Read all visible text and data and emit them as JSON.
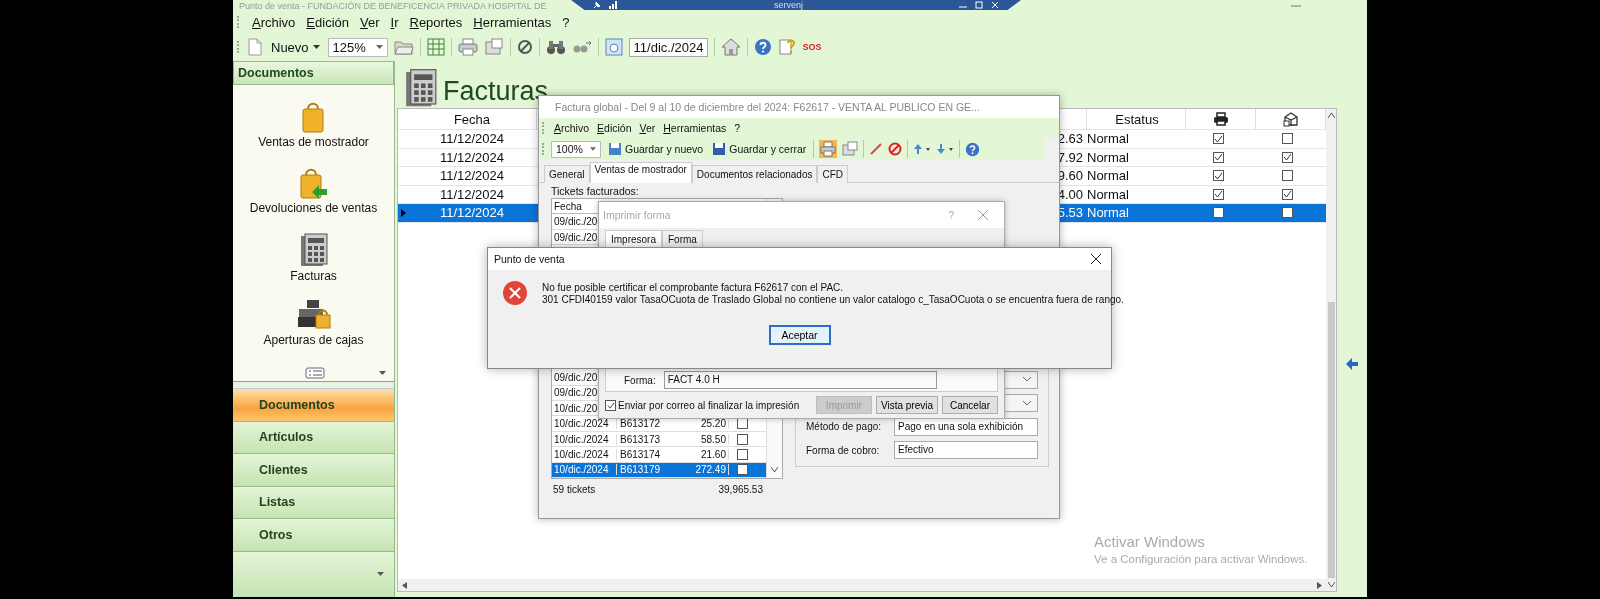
{
  "remote_bar": {
    "title": "servenj"
  },
  "window": {
    "title": "Punto de venta - FUNDACIÓN DE BENEFICENCIA PRIVADA HOSPITAL DE"
  },
  "menu": [
    "Archivo",
    "Edición",
    "Ver",
    "Ir",
    "Reportes",
    "Herramientas",
    "?"
  ],
  "toolbar": {
    "new_label": "Nuevo",
    "zoom": "125%",
    "date": "11/dic./2024",
    "sos": "SOS"
  },
  "sidebar": {
    "header": "Documentos",
    "items": [
      {
        "label": "Ventas de mostrador"
      },
      {
        "label": "Devoluciones de ventas"
      },
      {
        "label": "Facturas"
      },
      {
        "label": "Aperturas de cajas"
      }
    ],
    "nav": [
      {
        "label": "Documentos",
        "selected": true
      },
      {
        "label": "Artículos",
        "selected": false
      },
      {
        "label": "Clientes",
        "selected": false
      },
      {
        "label": "Listas",
        "selected": false
      },
      {
        "label": "Otros",
        "selected": false
      }
    ]
  },
  "page": {
    "title": "Facturas"
  },
  "table": {
    "columns": {
      "date": "Fecha",
      "status": "Estatus"
    },
    "rows": [
      {
        "date": "11/12/2024",
        "amount": "2.63",
        "status": "Normal",
        "printed": true,
        "sent": false,
        "selected": false
      },
      {
        "date": "11/12/2024",
        "amount": "7.92",
        "status": "Normal",
        "printed": true,
        "sent": true,
        "selected": false
      },
      {
        "date": "11/12/2024",
        "amount": "9.60",
        "status": "Normal",
        "printed": true,
        "sent": false,
        "selected": false
      },
      {
        "date": "11/12/2024",
        "amount": "4.00",
        "status": "Normal",
        "printed": true,
        "sent": true,
        "selected": false
      },
      {
        "date": "11/12/2024",
        "amount": "5.53",
        "status": "Normal",
        "printed": false,
        "sent": false,
        "selected": true
      }
    ]
  },
  "factura": {
    "title": "Factura global - Del 9 al 10 de diciembre del 2024: F62617 - VENTA AL PUBLICO EN GE...",
    "menu": [
      "Archivo",
      "Edición",
      "Ver",
      "Herramientas",
      "?"
    ],
    "zoom": "100%",
    "save_new": "Guardar y nuevo",
    "save_close": "Guardar y cerrar",
    "tabs": [
      {
        "label": "General",
        "selected": false
      },
      {
        "label": "Ventas de mostrador",
        "selected": true
      },
      {
        "label": "Documentos relacionados",
        "selected": false
      },
      {
        "label": "CFD",
        "selected": false
      }
    ],
    "tickets_label": "Tickets facturados:",
    "tickets_header": "Fecha",
    "tickets": [
      {
        "date": "09/dic./20"
      },
      {
        "date": "09/dic./20"
      },
      {
        "date": "09/dic./20"
      },
      {
        "date": "09/dic./20"
      },
      {
        "date": "10/dic./20"
      },
      {
        "date": "10/dic./2024",
        "ticket": "B613172",
        "amount": "25.20",
        "checked": false,
        "selected": false
      },
      {
        "date": "10/dic./2024",
        "ticket": "B613173",
        "amount": "58.50",
        "checked": false,
        "selected": false
      },
      {
        "date": "10/dic./2024",
        "ticket": "B613174",
        "amount": "21.60",
        "checked": false,
        "selected": false
      },
      {
        "date": "10/dic./2024",
        "ticket": "B613179",
        "amount": "272.49",
        "checked": false,
        "selected": true
      }
    ],
    "ticket_count": "59 tickets",
    "ticket_total": "39,965.53",
    "fields": [
      {
        "label": "Método de pago:",
        "value": "Pago en una sola exhibición"
      },
      {
        "label": "Forma de cobro:",
        "value": "Efectivo"
      }
    ]
  },
  "print_dialog": {
    "title": "Imprimir forma",
    "help": "?",
    "tabs": [
      {
        "label": "Impresora",
        "selected": true
      },
      {
        "label": "Forma",
        "selected": false
      }
    ],
    "form_label": "Forma:",
    "form_value": "FACT 4.0 H",
    "send_email": {
      "label": "Enviar por correo al finalizar la impresión",
      "checked": true
    },
    "buttons": [
      {
        "label": "Imprimir",
        "disabled": true
      },
      {
        "label": "Vista previa",
        "disabled": false
      },
      {
        "label": "Cancelar",
        "disabled": false
      }
    ]
  },
  "message": {
    "title": "Punto de venta",
    "lines": [
      "No fue posible certificar el comprobante factura F62617 con el PAC.",
      "301  CFDI40159 valor TasaOCuota de Traslado Global no contiene un valor catalogo c_TasaOCuota o se encuentra fuera de rango."
    ],
    "button": "Aceptar"
  },
  "activation": {
    "title": "Activar Windows",
    "text": "Ve a Configuración para activar Windows."
  }
}
